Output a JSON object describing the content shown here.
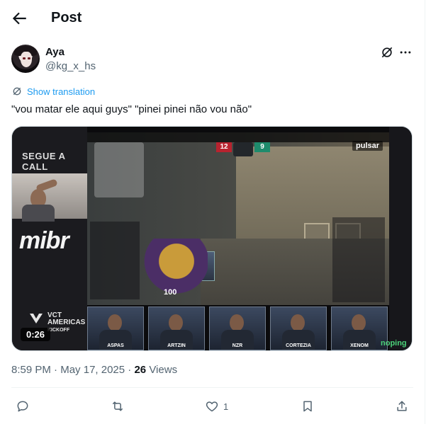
{
  "header": {
    "title": "Post"
  },
  "author": {
    "name": "Aya",
    "handle": "@kg_x_hs"
  },
  "translate": {
    "label": "Show translation"
  },
  "post": {
    "text": "\"vou matar ele aqui guys\" \"pinei pinei não vou não\""
  },
  "video": {
    "duration": "0:26",
    "overlay_text": {
      "segue": "SEGUE A CALL",
      "team": "mibr",
      "event": "VCT AMERICAS",
      "event_sub": "KICKOFF",
      "score_left": "12",
      "score_right": "9",
      "health": "100",
      "broadcaster": "pulsar",
      "sponsor": "noping"
    },
    "players": [
      "ASPAS",
      "ARTZIN",
      "NZR",
      "CORTEZIA",
      "XENOM"
    ]
  },
  "meta": {
    "time": "8:59 PM",
    "date": "May 17, 2025",
    "views_count": "26",
    "views_label": "Views",
    "dot": "·"
  },
  "actions": {
    "likes": "1"
  },
  "colors": {
    "accent": "#1d9bf0",
    "secondary_text": "#536471",
    "text": "#0f1419"
  }
}
